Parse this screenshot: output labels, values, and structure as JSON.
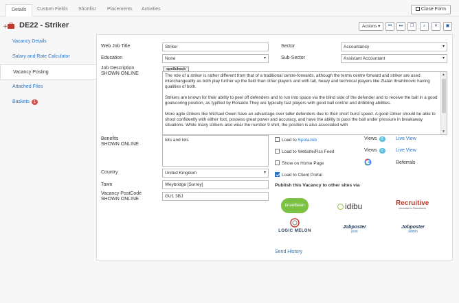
{
  "tabs": [
    "Details",
    "Custom Fields",
    "Shortlist",
    "Placements",
    "Activities"
  ],
  "close_form": "Close Form",
  "title": "DE22 - Striker",
  "actions_label": "Actions",
  "sidebar": [
    {
      "label": "Vacancy Details"
    },
    {
      "label": "Salary and Rate Calculator"
    },
    {
      "label": "Vacancy Posting"
    },
    {
      "label": "Attached Files"
    },
    {
      "label": "Baskets",
      "badge": "1"
    }
  ],
  "form": {
    "web_job_title_label": "Web Job Title",
    "web_job_title_value": "Striker",
    "education_label": "Education",
    "education_value": "None",
    "sector_label": "Sector",
    "sector_value": "Accountancy",
    "subsector_label": "Sub-Sector",
    "subsector_value": "Assistant Accountant",
    "job_desc_label": "Job Description",
    "shown_online": "SHOWN ONLINE",
    "spellcheck": "spellcheck",
    "description": [
      "The role of a striker is rather different from that of a traditional centre-forwards, although the terms centre forward and striker are used interchangeably as both play further up the field than other players and with tall, heavy and technical players like Zlatan Ibrahimovic having qualities of both.",
      "Strikers are known for their ability to peel off defenders and to run into space via the blind side of the defender and to receive the ball in a good goalscoring position, as typified by Ronaldo.They are typically fast players with good ball control and dribbling abilities.",
      "More agile strikers like Michael Owen have an advantage over taller defenders due to their short burst speed. A good striker should be able to shoot confidently with either foot, possess great power and accuracy, and have the ability to pass the ball under pressure in breakaway situations. While many strikers also wear the number 9 shirt, the position is also associated with"
    ],
    "benefits_label": "Benefits",
    "benefits_value": "lots and lots",
    "country_label": "Country",
    "country_value": "United Kingdom",
    "town_label": "Town",
    "town_value": "Weybridge [Surrey]",
    "postcode_label": "Vacancy  PostCode",
    "postcode_value": "GU1 3BJ"
  },
  "posting": {
    "load_to": "Load to",
    "spotajob": "SpotaJob",
    "website_rss": "Load to Website/Rss Feed",
    "show_home": "Show on Home Page",
    "client_portal": "Load to Client Portal",
    "views_label": "Views",
    "views_1": "0",
    "views_2": "0",
    "live_view": "Live View",
    "referrals": "Referrals",
    "publish_title": "Publish this Vacancy to other sites via",
    "send_history": "Send History"
  },
  "logos": {
    "broadbean": "broadbean",
    "idibu": "idibu",
    "recruitive": "Recruitive",
    "recruitive_tag": "innovation in Recruitment",
    "logicmelon": "LOGIC MELON",
    "jobposter1": "Jobposter",
    "jobposter1_sub": "post",
    "jobposter2": "Jobposter",
    "jobposter2_sub": "admin"
  },
  "colors": {
    "link": "#2a73c4",
    "badge": "#d9534f",
    "views_pill": "#5bc0de",
    "broadbean": "#7bc142",
    "recruitive": "#c0392b",
    "logicmelon": "#c0392b"
  }
}
